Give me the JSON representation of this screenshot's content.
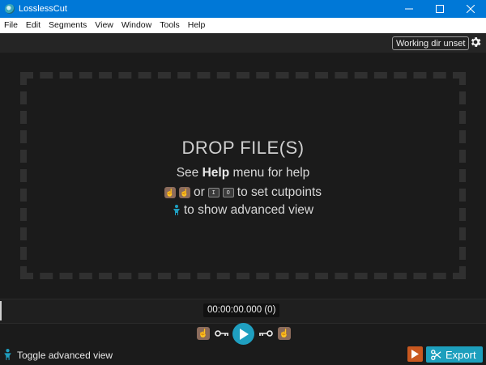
{
  "window": {
    "title": "LosslessCut"
  },
  "menu": [
    "File",
    "Edit",
    "Segments",
    "View",
    "Window",
    "Tools",
    "Help"
  ],
  "topbar": {
    "working_dir": "Working dir unset"
  },
  "dropzone": {
    "title": "DROP FILE(S)",
    "help_prefix": "See ",
    "help_bold": "Help",
    "help_suffix": " menu for help",
    "or_text": "or",
    "kbd_in": "I",
    "kbd_out": "O",
    "cutpoints_text": "to set cutpoints",
    "advanced_text": "to show advanced view"
  },
  "timeline": {
    "timecode": "00:00:00.000 (0)"
  },
  "bottom": {
    "toggle_advanced": "Toggle advanced view",
    "export": "Export"
  },
  "colors": {
    "accent": "#1f9fc0",
    "titlebar": "#0078d7",
    "export_play": "#c9581f",
    "hand": "#8b6b5b"
  },
  "icons": [
    "app-icon",
    "minimize-icon",
    "maximize-icon",
    "close-icon",
    "gear-icon",
    "hand-icon",
    "keyboard-key-icon",
    "person-icon",
    "play-icon",
    "key-icon",
    "scissors-icon"
  ]
}
